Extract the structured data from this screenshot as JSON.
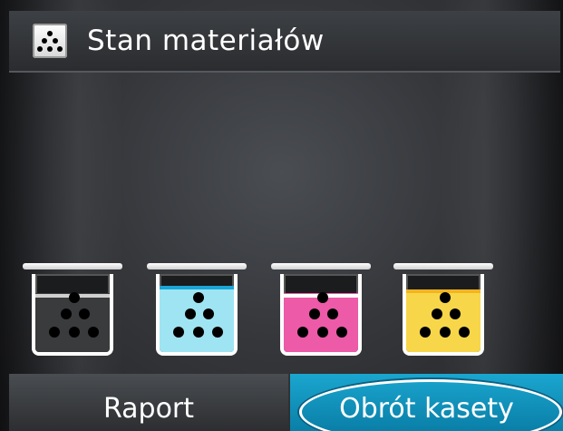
{
  "header": {
    "title": "Stan materiałów",
    "icon": "supplies-icon"
  },
  "cartridges": [
    {
      "name": "black",
      "color": "#3a3b3d",
      "stripe": "#d0d0d0",
      "level": 0.75
    },
    {
      "name": "cyan",
      "color": "#9fe4f2",
      "stripe": "#1aa6d6",
      "level": 0.85
    },
    {
      "name": "magenta",
      "color": "#ec5aa8",
      "stripe": "#ffffff",
      "level": 0.75
    },
    {
      "name": "yellow",
      "color": "#f7d64a",
      "stripe": "#f3b51f",
      "level": 0.8
    }
  ],
  "buttons": {
    "report_label": "Raport",
    "rotate_label": "Obrót kasety"
  },
  "colors": {
    "accent": "#1aa6cf"
  }
}
